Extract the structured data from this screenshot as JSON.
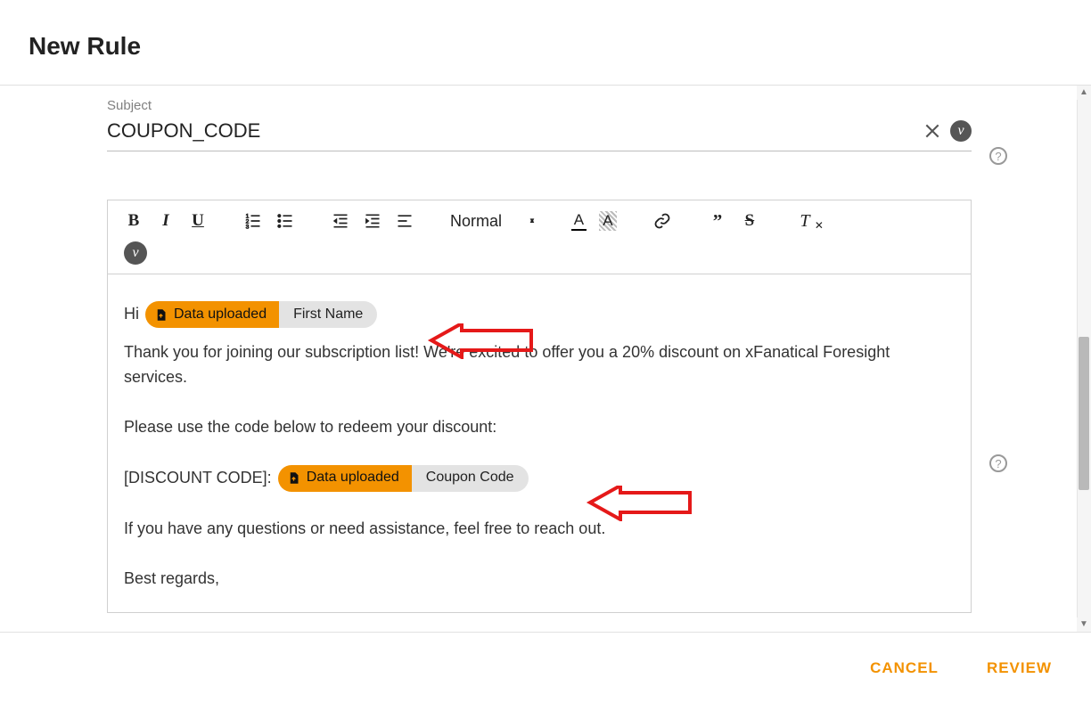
{
  "modal": {
    "title": "New Rule",
    "footer": {
      "cancel": "CANCEL",
      "review": "REVIEW"
    }
  },
  "subject": {
    "label": "Subject",
    "value": "COUPON_CODE"
  },
  "toolbar": {
    "format_label": "Normal"
  },
  "badge": {
    "v": "v"
  },
  "chips": {
    "data_uploaded": "Data uploaded",
    "first_name": "First Name",
    "coupon_code": "Coupon Code"
  },
  "body": {
    "hi": "Hi ",
    "thankyou": "Thank you for joining our subscription list! We're excited to offer you a 20% discount on xFanatical Foresight services.",
    "please_use": "Please use the code below to redeem your discount:",
    "discount_label": "[DISCOUNT CODE]: ",
    "questions": "If you have any questions or need assistance, feel free to reach out.",
    "best_regards": "Best regards,"
  }
}
